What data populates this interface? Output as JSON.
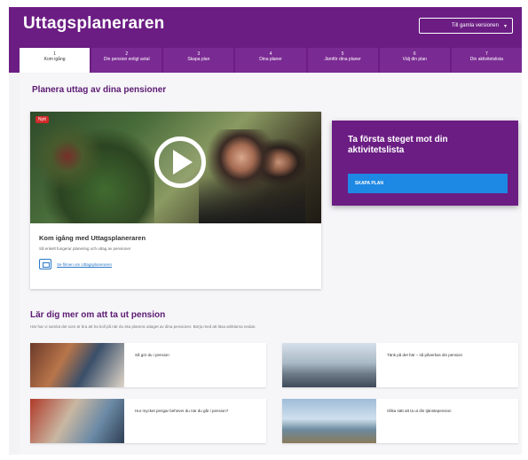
{
  "header": {
    "app_title": "Uttagsplaneraren",
    "dropdown_label": "Till gamla versionen"
  },
  "tabs": [
    {
      "num": "1",
      "label": "Kom igång"
    },
    {
      "num": "2",
      "label": "Din pension enligt avtal"
    },
    {
      "num": "3",
      "label": "Skapa plan"
    },
    {
      "num": "4",
      "label": "Dina planer"
    },
    {
      "num": "5",
      "label": "Jämför dina planer"
    },
    {
      "num": "6",
      "label": "Välj din plan"
    },
    {
      "num": "7",
      "label": "Din aktivitetslista"
    }
  ],
  "main": {
    "section_title": "Planera uttag av dina pensioner",
    "video": {
      "badge": "Nytt",
      "title": "Kom igång med Uttagsplaneraren",
      "description": "Så enkelt fungerar planering och uttag av pensioner",
      "link_text": "Se filmen om Uttagsplaneraren"
    },
    "step_card": {
      "title": "Ta första steget mot din aktivitetslista",
      "button": "SKAPA PLAN"
    },
    "learn": {
      "title": "Lär dig mer om att ta ut pension",
      "subtitle": "Här har vi samlat det som är bra att ha koll på när du ska planera uttaget av dina pensioner. Börja med att läsa artiklarna nedan.",
      "articles": [
        {
          "text": "Så gör du i pension"
        },
        {
          "text": "Tänk på det här – så påverkas din pension"
        },
        {
          "text": "Hur mycket pengar behöver du när du går i pension?"
        },
        {
          "text": "Olika sätt att ta ut din tjänstepension"
        }
      ]
    }
  }
}
